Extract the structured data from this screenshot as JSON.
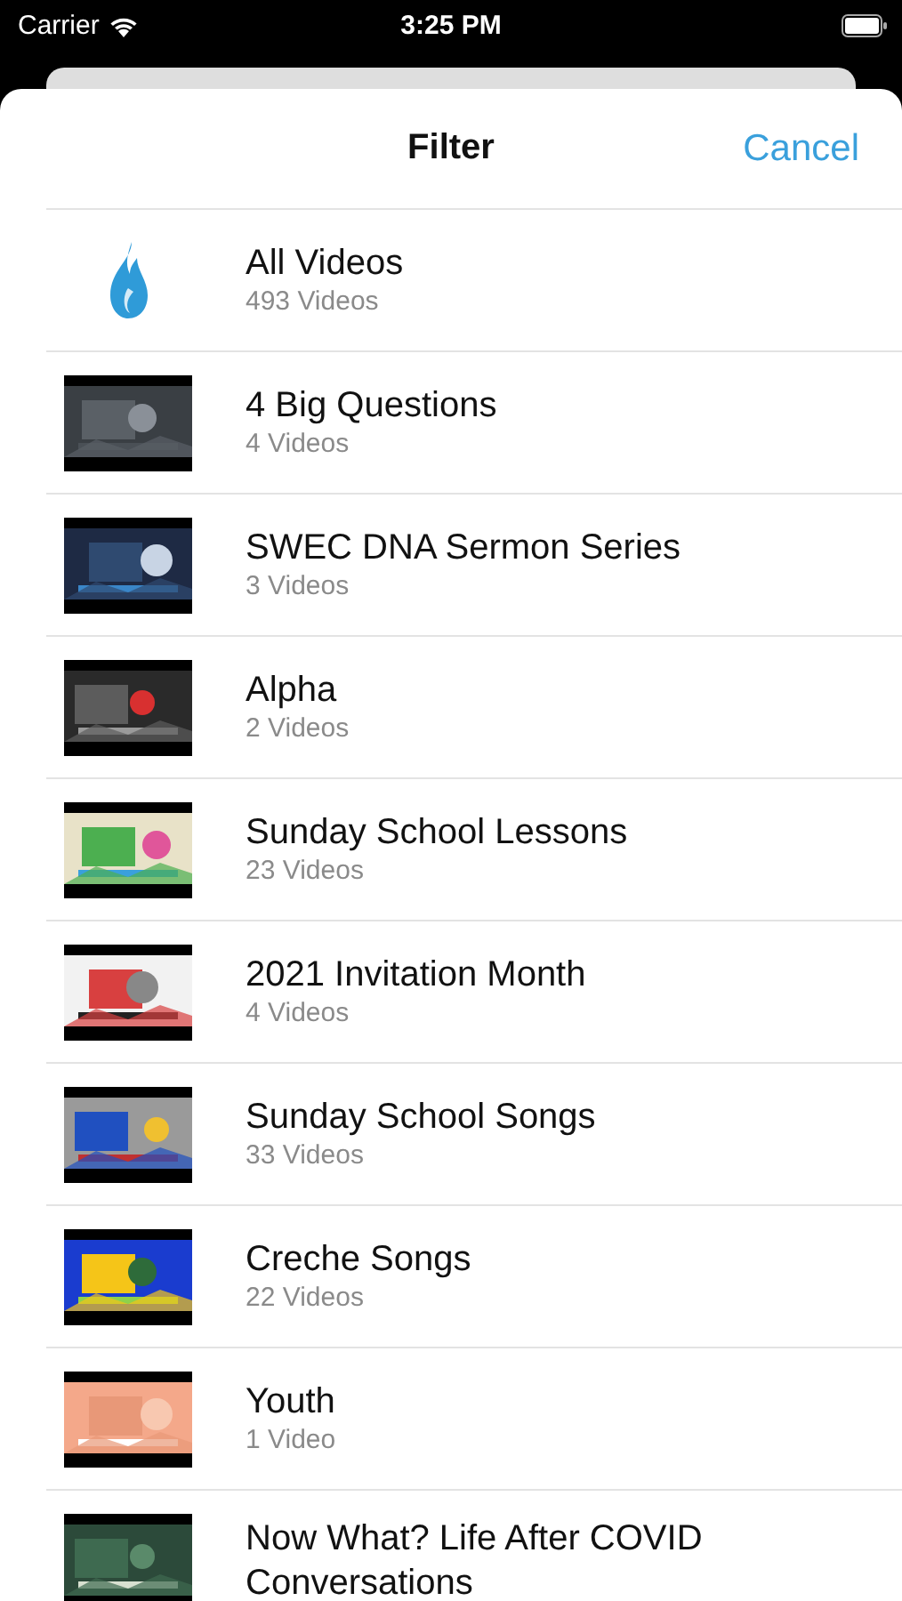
{
  "status_bar": {
    "carrier": "Carrier",
    "time": "3:25 PM"
  },
  "header": {
    "title": "Filter",
    "cancel": "Cancel"
  },
  "items": [
    {
      "kind": "logo",
      "title": "All Videos",
      "count": "493 Videos"
    },
    {
      "kind": "picture",
      "title": "4 Big Questions",
      "count": "4 Videos"
    },
    {
      "kind": "picture",
      "title": "SWEC DNA Sermon Series",
      "count": "3 Videos"
    },
    {
      "kind": "picture",
      "title": "Alpha",
      "count": "2 Videos"
    },
    {
      "kind": "picture",
      "title": "Sunday School Lessons",
      "count": "23 Videos"
    },
    {
      "kind": "picture",
      "title": "2021 Invitation Month",
      "count": "4 Videos"
    },
    {
      "kind": "picture",
      "title": "Sunday School Songs",
      "count": "33 Videos"
    },
    {
      "kind": "picture",
      "title": "Creche Songs",
      "count": "22 Videos"
    },
    {
      "kind": "picture",
      "title": "Youth",
      "count": "1 Video"
    },
    {
      "kind": "picture",
      "title": "Now What? Life After COVID Conversations"
    }
  ]
}
